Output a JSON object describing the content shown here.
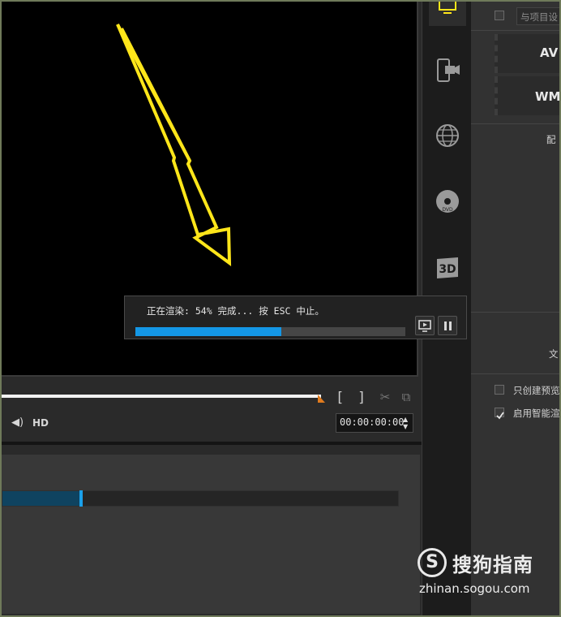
{
  "render_dialog": {
    "status_text": "正在渲染: 54% 完成... 按 ESC 中止。",
    "progress_percent": 54,
    "preview_button": "preview-icon",
    "pause_button": "pause-icon"
  },
  "player_controls": {
    "mark_in": "[",
    "mark_out": "]",
    "volume_icon": "speaker-icon",
    "hd_label": "HD",
    "timecode": "00:00:00:00"
  },
  "lower_panel": {
    "progress_fraction": 0.2
  },
  "toolbar": {
    "items": [
      "monitor-icon",
      "mobile-device-icon",
      "globe-icon",
      "disc-icon",
      "3d-icon"
    ]
  },
  "right_panel": {
    "match_project_label": "与项目设",
    "formats": [
      "AV",
      "WM"
    ],
    "config_label": "配",
    "side_label_1": "",
    "file_label": "文",
    "only_preview_label": "只创建预览",
    "smart_render_label": "启用智能渲",
    "smart_render_checked": true,
    "only_preview_checked": false
  },
  "watermark": {
    "logo_letter": "S",
    "title": "搜狗指南",
    "url": "zhinan.sogou.com"
  },
  "colors": {
    "progress": "#1497e6",
    "arrow": "#ffe61a",
    "marker": "#e07b1e"
  }
}
